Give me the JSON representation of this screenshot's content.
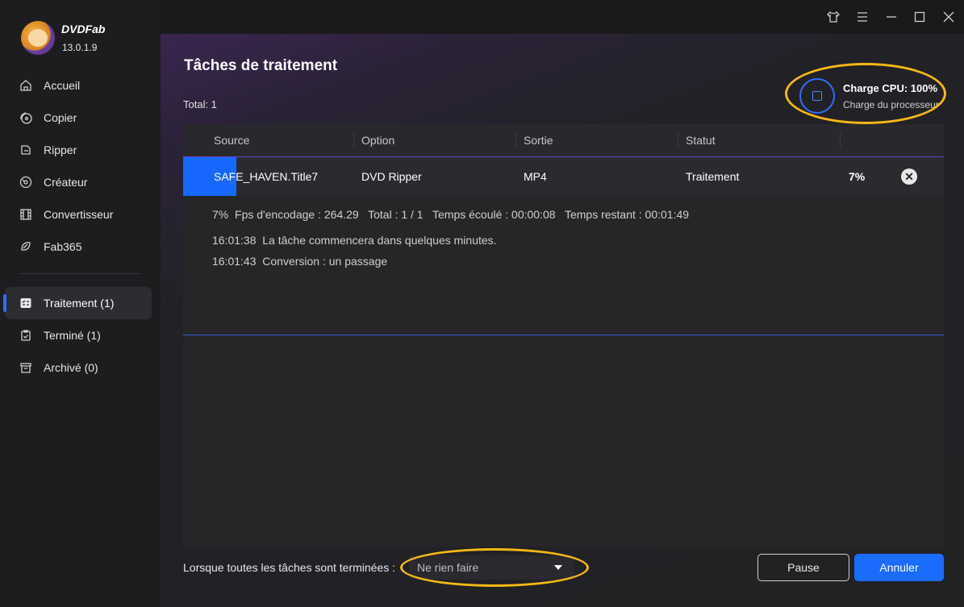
{
  "app": {
    "name": "DVDFab",
    "version": "13.0.1.9"
  },
  "sidebar": {
    "items": [
      {
        "label": "Accueil",
        "icon": "home-icon"
      },
      {
        "label": "Copier",
        "icon": "copy-disc-icon"
      },
      {
        "label": "Ripper",
        "icon": "ripper-icon"
      },
      {
        "label": "Créateur",
        "icon": "creator-disc-icon"
      },
      {
        "label": "Convertisseur",
        "icon": "film-icon"
      },
      {
        "label": "Fab365",
        "icon": "fab365-icon"
      }
    ],
    "queue": [
      {
        "label": "Traitement (1)",
        "icon": "task-list-icon",
        "active": true
      },
      {
        "label": "Terminé (1)",
        "icon": "clipboard-check-icon"
      },
      {
        "label": "Archivé (0)",
        "icon": "archive-icon"
      }
    ]
  },
  "titlebar": {
    "icons": [
      "shirt-skin-icon",
      "menu-icon",
      "minimize-icon",
      "maximize-icon",
      "close-icon"
    ]
  },
  "main": {
    "title": "Tâches de traitement",
    "total": "Total: 1",
    "cpu": {
      "main": "Charge CPU: 100%",
      "sub": "Charge du processeur"
    },
    "table": {
      "columns": [
        "Source",
        "Option",
        "Sortie",
        "Statut"
      ],
      "row": {
        "source": "SAFE_HAVEN.Title7",
        "option": "DVD Ripper",
        "output": "MP4",
        "status": "Traitement",
        "percent": "7%",
        "progress": 0.07
      },
      "detail": {
        "stats": "7%  Fps d'encodage : 264.29   Total : 1 / 1   Temps écoulé : 00:00:08   Temps restant : 00:01:49",
        "log": [
          "16:01:38  La tâche commencera dans quelques minutes.",
          "16:01:43  Conversion : un passage"
        ]
      }
    },
    "footer": {
      "label": "Lorsque toutes les tâches sont terminées :",
      "select_value": "Ne rien faire",
      "pause": "Pause",
      "cancel": "Annuler"
    }
  },
  "colors": {
    "accent": "#1a6cff",
    "highlight": "#f5b816"
  }
}
